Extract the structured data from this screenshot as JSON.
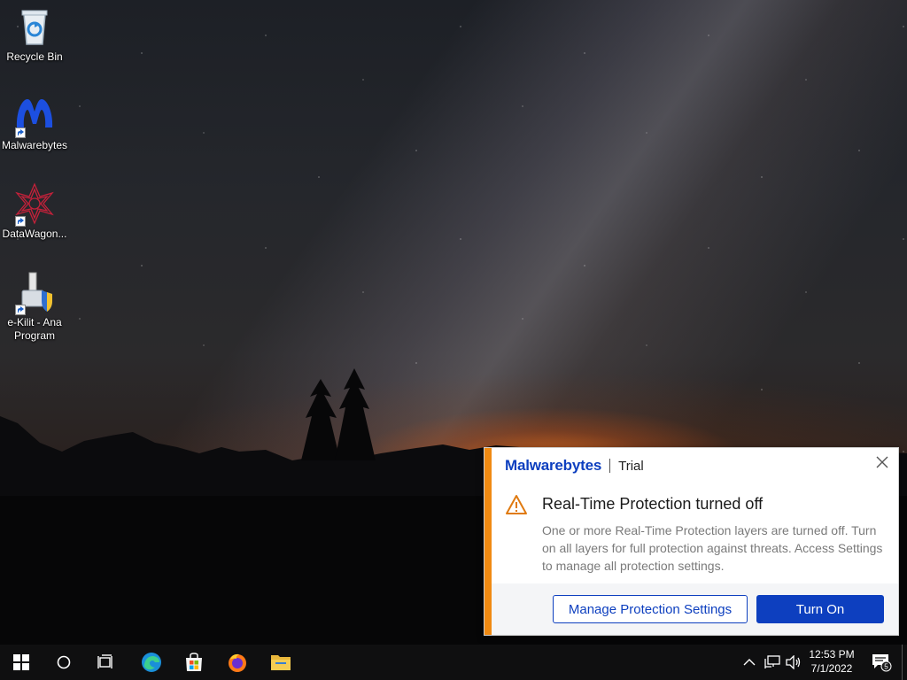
{
  "desktop": {
    "icons": [
      {
        "label": "Recycle Bin",
        "icon": "recycle-bin-icon"
      },
      {
        "label": "Malwarebytes",
        "icon": "malwarebytes-icon"
      },
      {
        "label": "DataWagon...",
        "icon": "datawagon-icon"
      },
      {
        "label": "e-Kilit - Ana Program",
        "icon": "ekilit-icon"
      }
    ]
  },
  "notification": {
    "brand": "Malwarebytes",
    "edition": "Trial",
    "title": "Real-Time Protection turned off",
    "body": "One or more Real-Time Protection layers are turned off. Turn on all layers for full protection against threats. Access Settings to manage all protection settings.",
    "secondary_button": "Manage Protection Settings",
    "primary_button": "Turn On",
    "accent_color": "#f08a12",
    "brand_color": "#0d3fbf"
  },
  "taskbar": {
    "pinned": [
      "start-icon",
      "search-icon",
      "task-view-icon",
      "edge-icon",
      "store-icon",
      "firefox-icon",
      "file-explorer-icon"
    ],
    "clock": {
      "time": "12:53 PM",
      "date": "7/1/2022"
    },
    "notification_count": "5"
  }
}
